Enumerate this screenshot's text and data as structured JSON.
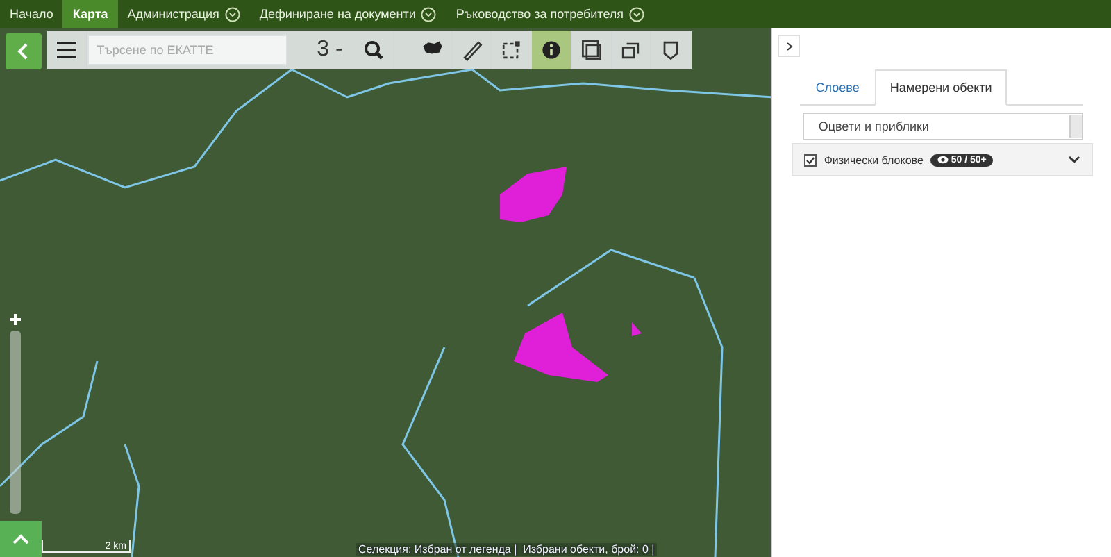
{
  "nav": [
    {
      "label": "Начало",
      "selected": false,
      "dropdown": false
    },
    {
      "label": "Карта",
      "selected": true,
      "dropdown": false
    },
    {
      "label": "Администрация",
      "selected": false,
      "dropdown": true
    },
    {
      "label": "Дефиниране на документи",
      "selected": false,
      "dropdown": true
    },
    {
      "label": "Ръководство за потребителя",
      "selected": false,
      "dropdown": true
    }
  ],
  "toolbar": {
    "search": {
      "placeholder": "Търсене по ЕКАТТЕ"
    },
    "zoom_level": "3 -",
    "tools": [
      {
        "kind": "country",
        "selected": false
      },
      {
        "kind": "ruler",
        "selected": false
      },
      {
        "kind": "select",
        "selected": false
      },
      {
        "kind": "info",
        "selected": true
      },
      {
        "kind": "layers",
        "selected": false
      },
      {
        "kind": "copy",
        "selected": false
      },
      {
        "kind": "pin",
        "selected": false
      }
    ]
  },
  "map": {
    "scale": "2 km",
    "status": "Селекция: Избран от легенда |  Избрани обекти, брой: 0 |"
  },
  "panel": {
    "tabs": [
      {
        "label": "Слоеве",
        "selected": false
      },
      {
        "label": "Намерени обекти",
        "selected": true
      }
    ],
    "select": {
      "value": "Оцвети и приблики"
    },
    "layers": [
      {
        "name": "Физически блокове",
        "checked": true,
        "count": "50 / 50+"
      }
    ]
  }
}
